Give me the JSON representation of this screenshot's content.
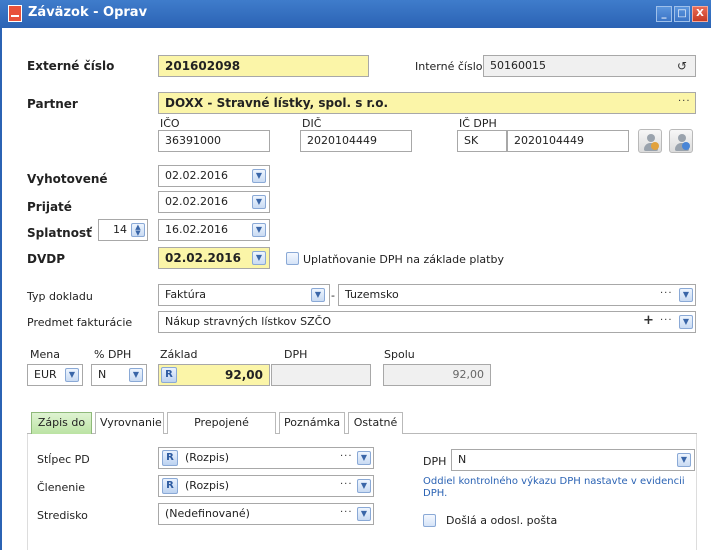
{
  "window": {
    "title": "Záväzok - Oprav",
    "minimize": "_",
    "maximize": "□",
    "close": "X"
  },
  "external_number": {
    "label": "Externé číslo",
    "value": "201602098"
  },
  "internal_number": {
    "label": "Interné číslo",
    "value": "50160015",
    "icon": "refresh-icon"
  },
  "partner": {
    "label": "Partner",
    "value": "DOXX - Stravné lístky, spol. s r.o.",
    "ico_label": "IČO",
    "ico": "36391000",
    "dic_label": "DIČ",
    "dic": "2020104449",
    "icdph_label": "IČ DPH",
    "icdph_prefix": "SK",
    "icdph": "2020104449"
  },
  "dates": {
    "vyhotovene_label": "Vyhotovené",
    "vyhotovene": "02.02.2016",
    "prijate_label": "Prijaté",
    "prijate": "02.02.2016",
    "splatnost_label": "Splatnosť",
    "splatnost_days": "14",
    "splatnost": "16.02.2016",
    "dvdp_label": "DVDP",
    "dvdp": "02.02.2016",
    "uplatnovanie_label": "Uplatňovanie DPH na základe platby"
  },
  "doc_type": {
    "label": "Typ dokladu",
    "value": "Faktúra",
    "separator": "-",
    "region": "Tuzemsko"
  },
  "subject": {
    "label": "Predmet fakturácie",
    "value": "Nákup stravných lístkov SZČO"
  },
  "amounts": {
    "mena_label": "Mena",
    "mena": "EUR",
    "dph_pct_label": "% DPH",
    "dph_pct": "N",
    "zaklad_label": "Základ",
    "zaklad_badge": "R",
    "zaklad": "92,00",
    "dph_label": "DPH",
    "dph": "",
    "spolu_label": "Spolu",
    "spolu": "92,00"
  },
  "tabs": [
    {
      "label": "Zápis do"
    },
    {
      "label": "Vyrovnanie"
    },
    {
      "label": "Prepojené doklady"
    },
    {
      "label": "Poznámka"
    },
    {
      "label": "Ostatné"
    }
  ],
  "tab_panel": {
    "stlpec_label": "Stĺpec PD",
    "stlpec_badge": "R",
    "stlpec": "(Rozpis)",
    "clenenie_label": "Členenie",
    "clenenie_badge": "R",
    "clenenie": "(Rozpis)",
    "stredisko_label": "Stredisko",
    "stredisko": "(Nedefinované)",
    "dph_label": "DPH",
    "dph": "N",
    "note": "Oddiel kontrolného výkazu DPH nastavte v evidencii DPH.",
    "posta_label": "Došlá a odosl. pošta"
  },
  "common": {
    "dots": "···",
    "plus": "+",
    "dropdown": "▼"
  }
}
